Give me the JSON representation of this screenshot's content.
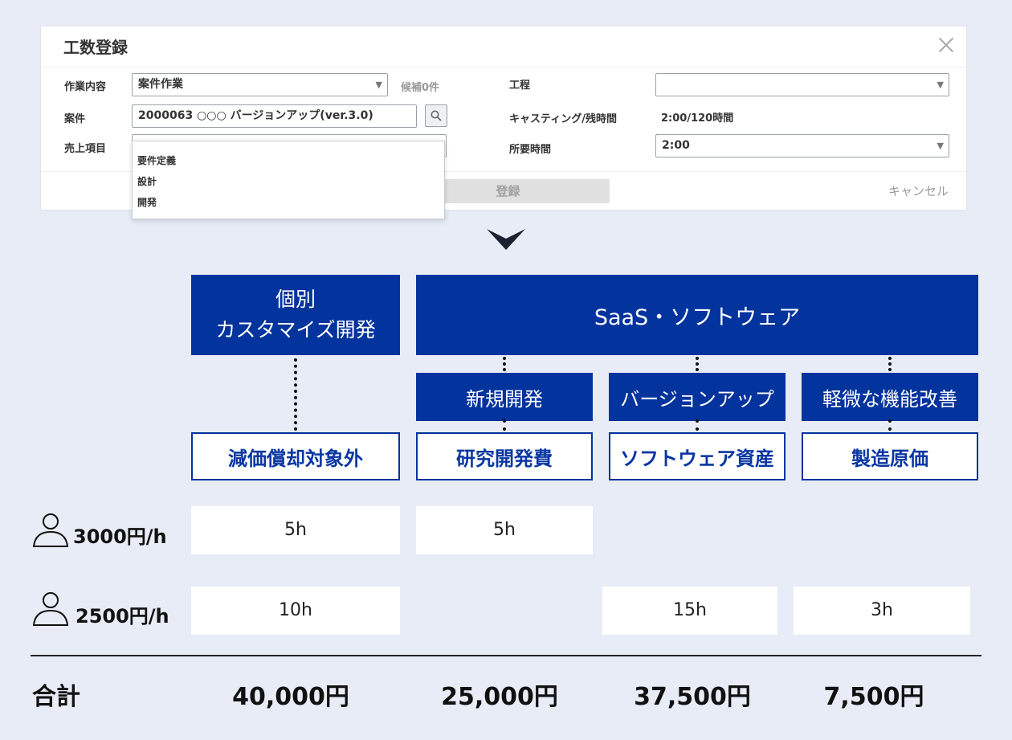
{
  "dialog": {
    "title": "工数登録",
    "fields": {
      "work_content_label": "作業内容",
      "work_content_value": "案件作業",
      "candidates": "候補0件",
      "project_label": "案件",
      "project_value": "2000063 ○○○ バージョンアップ(ver.3.0)",
      "sales_item_label": "売上項目",
      "sales_item_value": "",
      "process_label": "工程",
      "process_value": "",
      "casting_label": "キャスティング/残時間",
      "casting_value": "2:00/120時間",
      "required_time_label": "所要時間",
      "required_time_value": "2:00"
    },
    "dropdown_options": [
      "要件定義",
      "設計",
      "開発"
    ],
    "register_label": "登録",
    "cancel_label": "キャンセル"
  },
  "diagram": {
    "custom_box_line1": "個別",
    "custom_box_line2": "カスタマイズ開発",
    "saas_box": "SaaS・ソフトウェア",
    "subcategories": [
      "新規開発",
      "バージョンアップ",
      "軽微な機能改善"
    ],
    "accounting": [
      "減価償却対象外",
      "研究開発費",
      "ソフトウェア資産",
      "製造原価"
    ],
    "rows": [
      {
        "rate": "3000円/h",
        "hours": [
          "5h",
          "5h",
          "",
          ""
        ]
      },
      {
        "rate": "2500円/h",
        "hours": [
          "10h",
          "",
          "15h",
          "3h"
        ]
      }
    ],
    "total_label": "合計",
    "totals": [
      "40,000円",
      "25,000円",
      "37,500円",
      "7,500円"
    ],
    "colors": {
      "navy": "#03339d",
      "background": "#e7ecf6"
    }
  }
}
